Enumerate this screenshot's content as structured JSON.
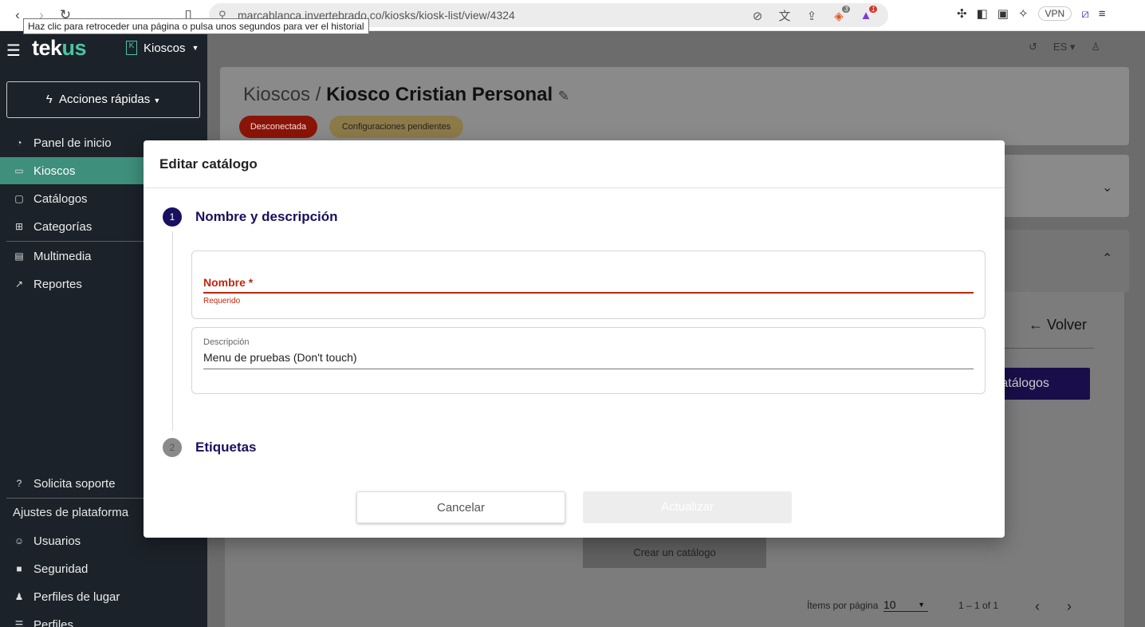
{
  "browser": {
    "url": "marcablanca.invertebrado.co/kiosks/kiosk-list/view/4324",
    "tooltip": "Haz clic para retroceder una página o pulsa unos segundos para ver el historial",
    "vpn_label": "VPN",
    "brave_count": "3",
    "rewards_count": "1"
  },
  "sidebar": {
    "logo_part1": "tek",
    "logo_part2": "us",
    "kiosk_switch": "Kioscos",
    "kiosk_badge": "K",
    "quick_actions": "Acciones rápidas",
    "items": [
      {
        "label": "Panel de inicio",
        "icon": "dashboard-icon"
      },
      {
        "label": "Kioscos",
        "icon": "kiosk-icon"
      },
      {
        "label": "Catálogos",
        "icon": "book-icon"
      },
      {
        "label": "Categorías",
        "icon": "sitemap-icon"
      },
      {
        "label": "Multimedia",
        "icon": "images-icon"
      },
      {
        "label": "Reportes",
        "icon": "chart-icon"
      }
    ],
    "support": "Solicita soporte",
    "platform_settings": "Ajustes de plataforma",
    "settings_items": [
      {
        "label": "Usuarios",
        "icon": "users-icon"
      },
      {
        "label": "Seguridad",
        "icon": "lock-icon"
      },
      {
        "label": "Perfiles de lugar",
        "icon": "place-icon"
      },
      {
        "label": "Perfiles",
        "icon": "list-icon"
      }
    ]
  },
  "topbar": {
    "language": "ES"
  },
  "header": {
    "crumb_parent": "Kioscos",
    "crumb_sep": "/",
    "crumb_current": "Kiosco Cristian Personal",
    "status_disconnected": "Desconectada",
    "status_pending": "Configuraciones pendientes"
  },
  "background": {
    "back_label": "Volver",
    "add_catalogs": "Agregar catálogos",
    "create_catalog": "Crear un catálogo",
    "items_per_page_label": "Ítems por página",
    "items_per_page": "10",
    "range": "1 – 1 of 1"
  },
  "modal": {
    "title": "Editar catálogo",
    "step1_number": "1",
    "step1_title": "Nombre y descripción",
    "name_label": "Nombre *",
    "name_error": "Requerido",
    "name_value": "",
    "description_label": "Descripción",
    "description_value": "Menu de pruebas (Don't touch)",
    "step2_number": "2",
    "step2_title": "Etiquetas",
    "cancel": "Cancelar",
    "update": "Actualizar"
  }
}
